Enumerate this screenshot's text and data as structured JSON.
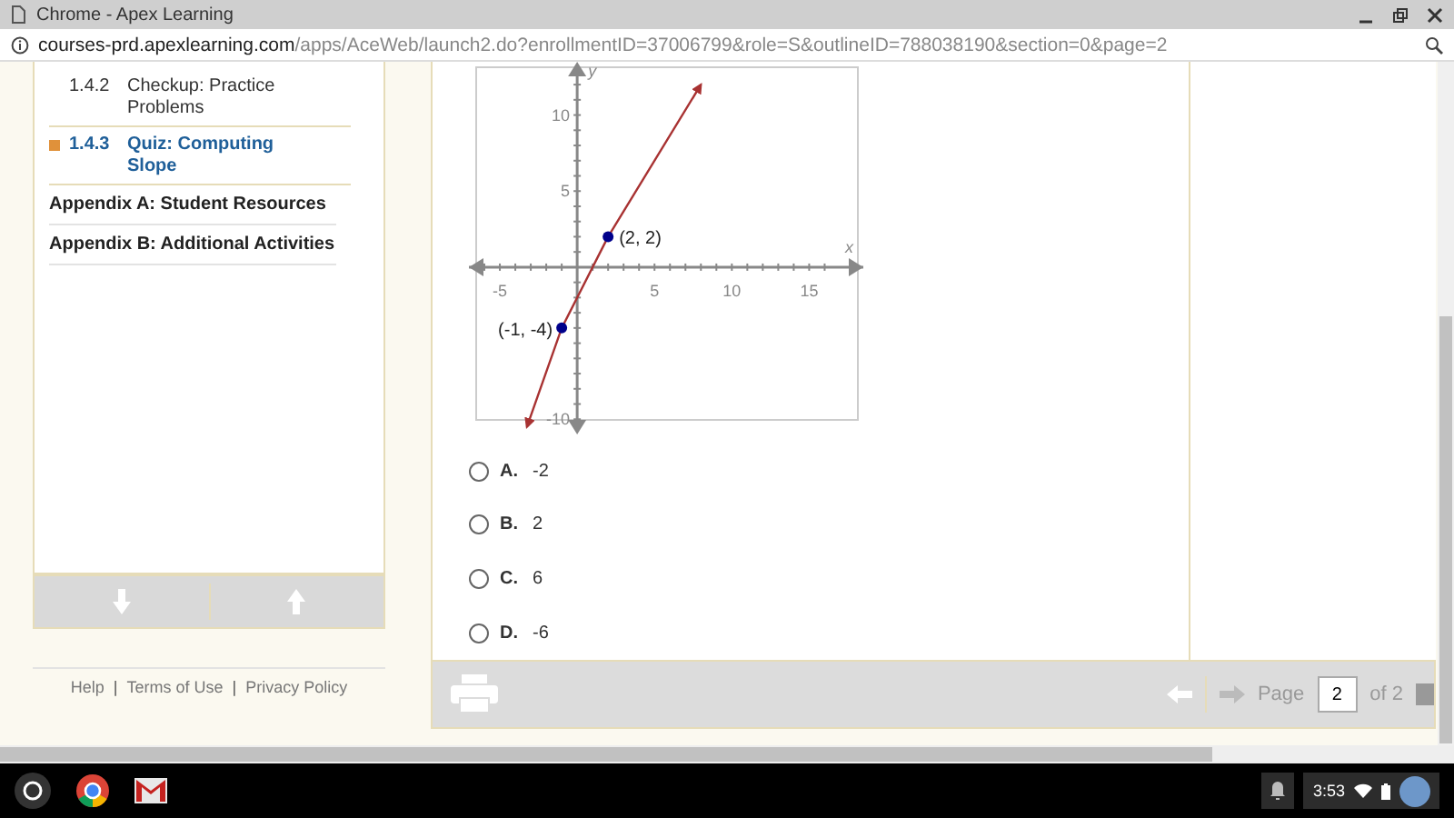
{
  "window": {
    "title": "Chrome - Apex Learning"
  },
  "address_bar": {
    "domain": "courses-prd.apexlearning.com",
    "path": "/apps/AceWeb/launch2.do?enrollmentID=37006799&role=S&outlineID=788038190&section=0&page=2"
  },
  "sidebar": {
    "items": [
      {
        "number": "1.4.2",
        "label": "Checkup: Practice Problems",
        "selected": false
      },
      {
        "number": "1.4.3",
        "label": "Quiz: Computing Slope",
        "selected": true
      }
    ],
    "appendices": [
      "Appendix A: Student Resources",
      "Appendix B: Additional Activities"
    ]
  },
  "footer_links": [
    "Help",
    "Terms of Use",
    "Privacy Policy"
  ],
  "footer_separator": "|",
  "question": {
    "chart_data": {
      "type": "line",
      "xlabel": "x",
      "ylabel": "y",
      "x": [
        -3.25,
        -1,
        2,
        8
      ],
      "series": [
        {
          "color": "#a83232",
          "values": [
            -10.5,
            -4,
            2,
            12
          ]
        }
      ],
      "xlim": [
        -7,
        18.5
      ],
      "ylim": [
        -11,
        13.5
      ],
      "xticks": [
        -5,
        5,
        10,
        15
      ],
      "yticks": [
        -10,
        5,
        10
      ],
      "annotations": [
        {
          "x": 2,
          "y": 2,
          "text": "(2, 2)"
        },
        {
          "x": -1,
          "y": -4,
          "text": "(-1, -4)"
        }
      ]
    },
    "options": [
      {
        "letter": "A.",
        "value": "-2",
        "selected": false
      },
      {
        "letter": "B.",
        "value": "2",
        "selected": false
      },
      {
        "letter": "C.",
        "value": "6",
        "selected": false
      },
      {
        "letter": "D.",
        "value": "-6",
        "selected": false
      }
    ]
  },
  "pager": {
    "label": "Page",
    "value": "2",
    "total": "of 2"
  },
  "taskbar": {
    "time": "3:53"
  }
}
